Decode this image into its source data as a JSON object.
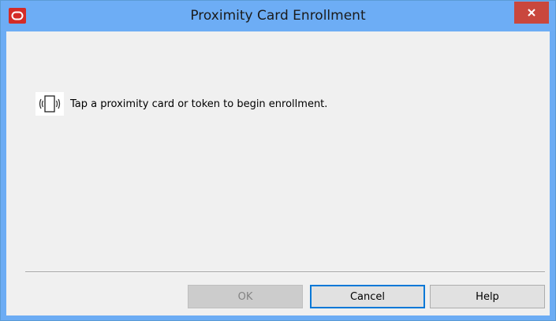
{
  "window": {
    "title": "Proximity Card Enrollment",
    "app_icon": "oracle-logo-icon",
    "close_icon": "close-icon"
  },
  "content": {
    "message": "Tap a proximity card or token to begin enrollment.",
    "message_icon": "proximity-card-icon"
  },
  "buttons": {
    "ok": "OK",
    "cancel": "Cancel",
    "help": "Help"
  },
  "colors": {
    "titlebar": "#6dadf5",
    "close_button": "#c9473d",
    "app_icon": "#d42b27",
    "dialog_background": "#f0f0f0",
    "default_button_border": "#0078d7"
  }
}
